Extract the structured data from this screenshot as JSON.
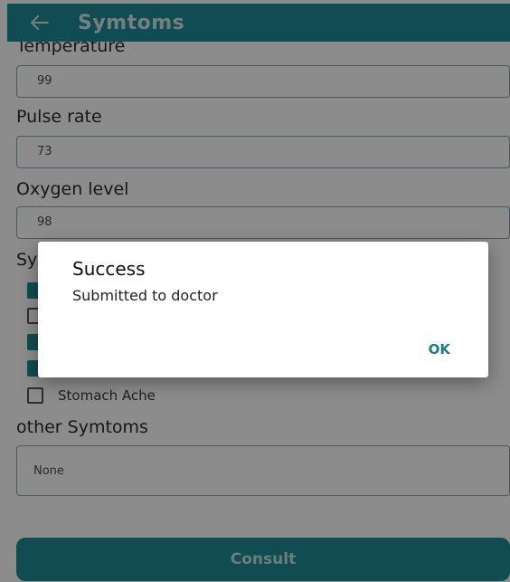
{
  "appbar": {
    "back_icon": "arrow-left-icon",
    "title": "Symtoms"
  },
  "fields": [
    {
      "label": "Temperature",
      "value": "99"
    },
    {
      "label": "Pulse rate",
      "value": "73"
    },
    {
      "label": "Oxygen level",
      "value": "98"
    }
  ],
  "symptoms": {
    "section_label_visible": "Sy",
    "items": [
      {
        "checked": true,
        "label": ""
      },
      {
        "checked": false,
        "label": ""
      },
      {
        "checked": true,
        "label": ""
      },
      {
        "checked": true,
        "label": ""
      },
      {
        "checked": false,
        "label": "Stomach Ache"
      }
    ]
  },
  "other": {
    "label": "other Symtoms",
    "value": "None"
  },
  "consult": {
    "label": "Consult"
  },
  "dialog": {
    "title": "Success",
    "message": "Submitted to doctor",
    "ok_label": "OK"
  },
  "colors": {
    "primary": "#1f8a97",
    "scrim": "rgba(0,0,0,0.45)"
  }
}
